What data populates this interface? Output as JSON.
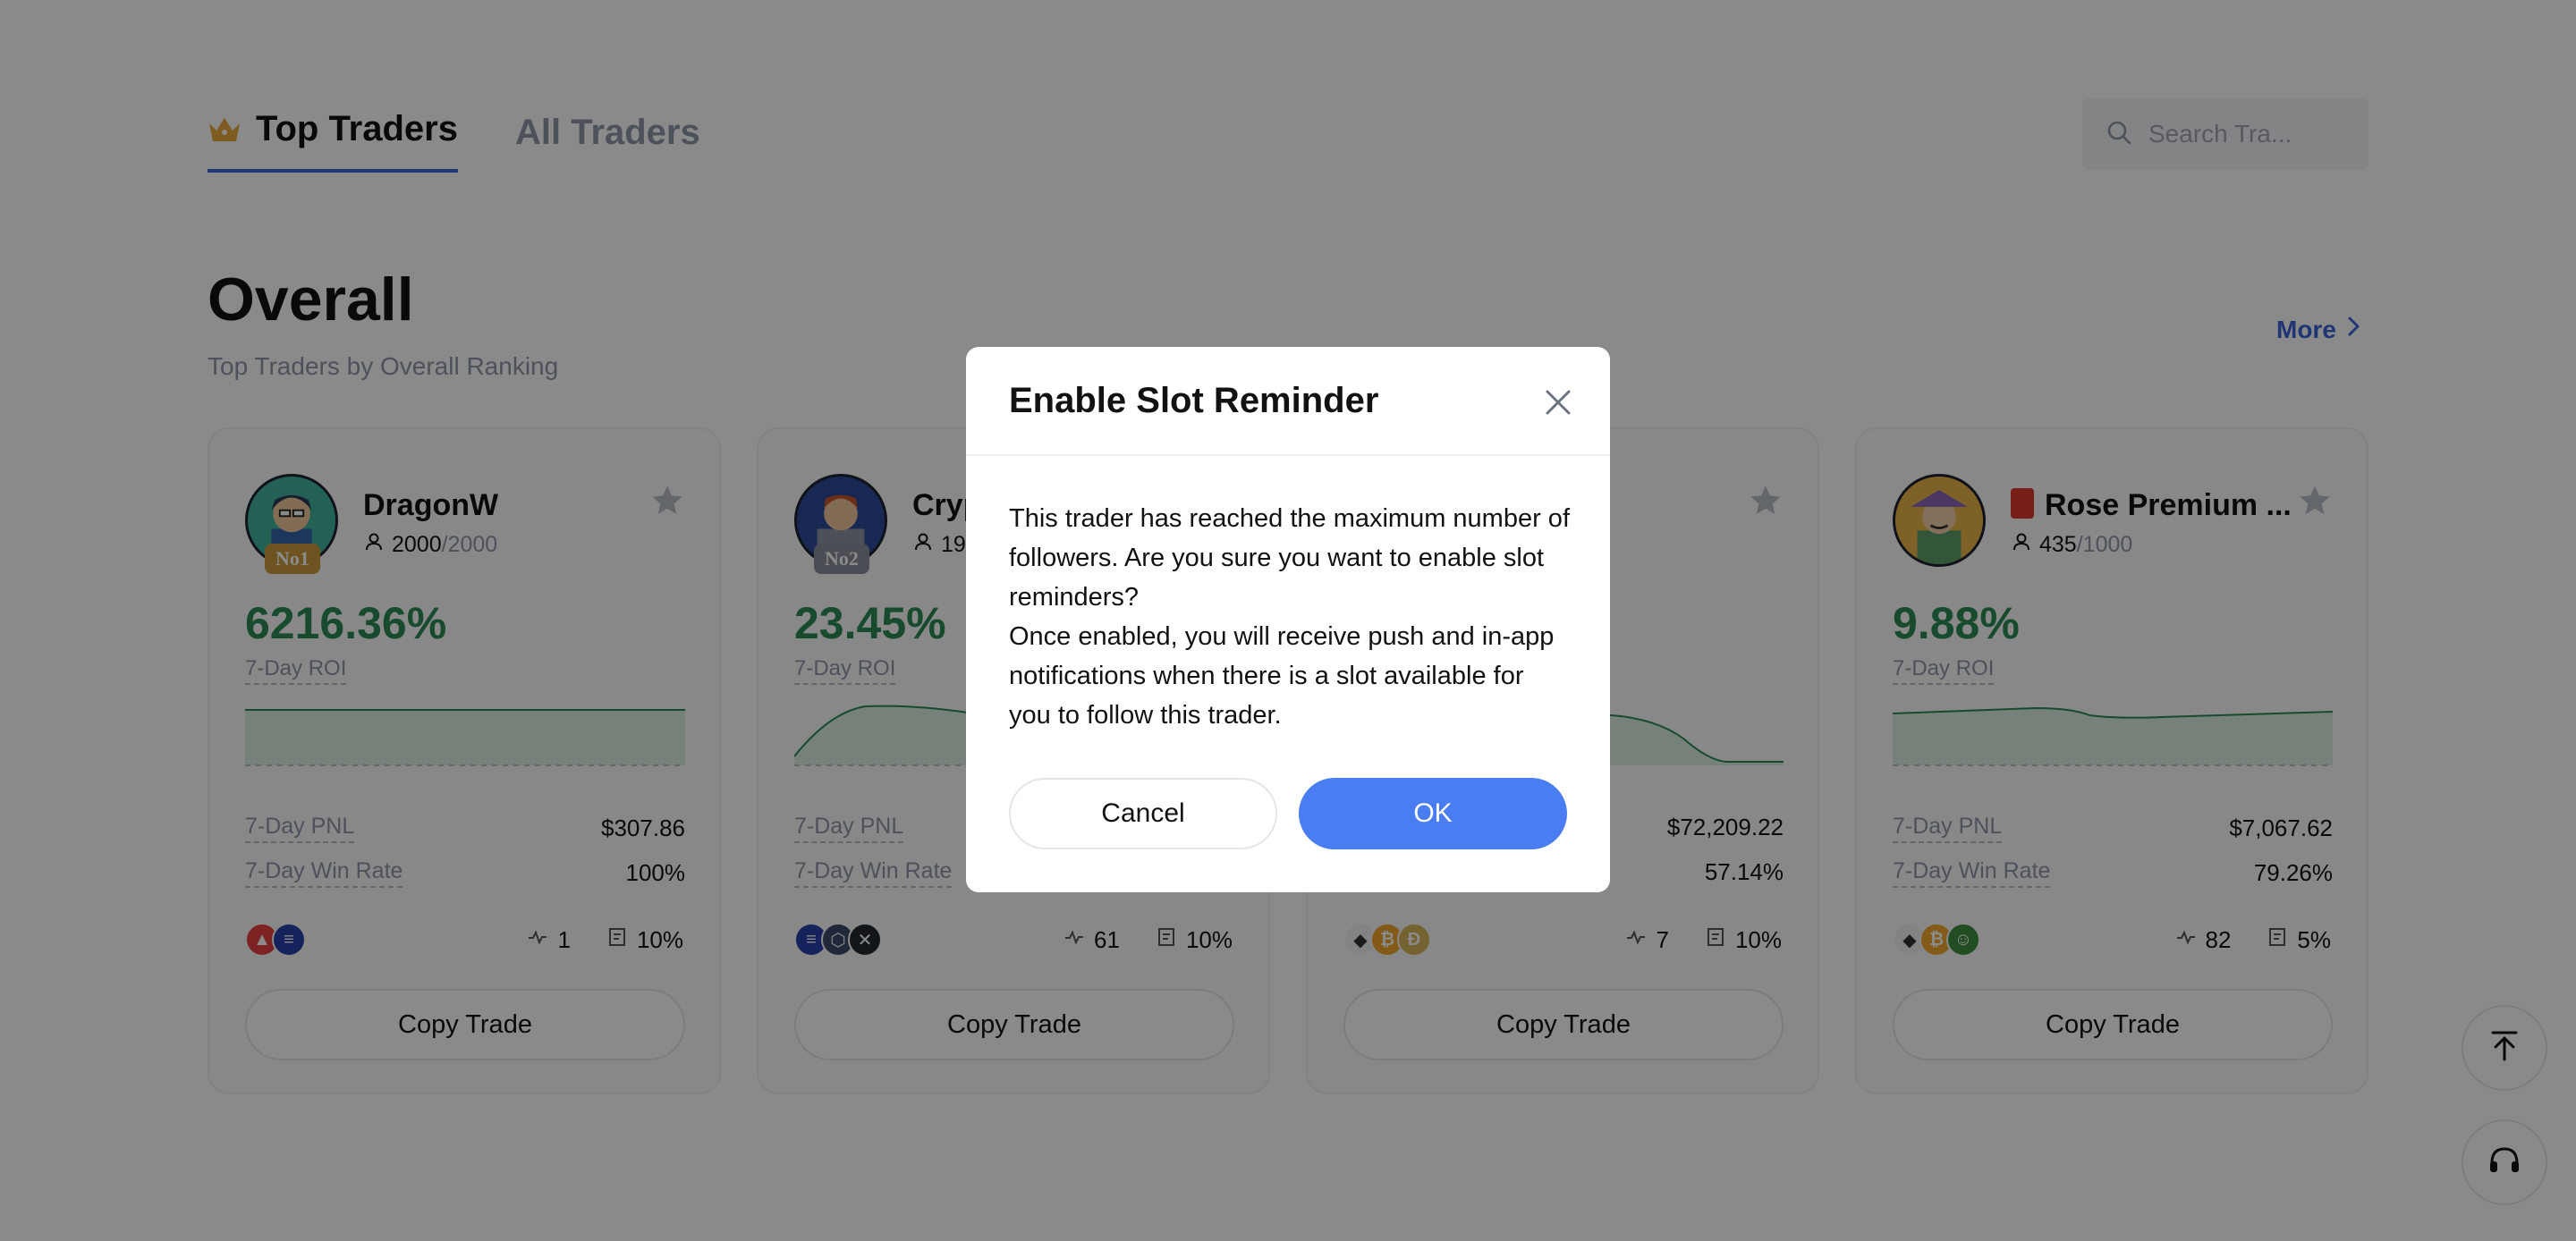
{
  "tabs": {
    "top_traders": "Top Traders",
    "all_traders": "All Traders"
  },
  "search": {
    "placeholder": "Search Tra..."
  },
  "section": {
    "title": "Overall",
    "subtitle": "Top Traders by Overall Ranking",
    "more": "More"
  },
  "cards": [
    {
      "name": "DragonW",
      "rank": "No1",
      "followers": "2000",
      "followers_max": "/2000",
      "roi": "6216.36%",
      "roi_label": "7-Day ROI",
      "pnl_label": "7-Day PNL",
      "pnl": "$307.86",
      "win_label": "7-Day Win Rate",
      "win": "100%",
      "trades": "1",
      "share": "10%",
      "copy": "Copy Trade"
    },
    {
      "name": "Cryp",
      "rank": "No2",
      "followers": "19",
      "followers_max": "",
      "roi": "23.45%",
      "roi_label": "7-Day ROI",
      "pnl_label": "7-Day PNL",
      "pnl": "",
      "win_label": "7-Day Win Rate",
      "win": "",
      "trades": "61",
      "share": "10%",
      "copy": "Copy Trade"
    },
    {
      "name": "",
      "rank": "",
      "followers": "",
      "followers_max": "",
      "roi": "",
      "roi_label": "",
      "pnl_label": "",
      "pnl": "$72,209.22",
      "win_label": "",
      "win": "57.14%",
      "trades": "7",
      "share": "10%",
      "copy": "Copy Trade"
    },
    {
      "name": "Rose Premium ...",
      "rank": "",
      "followers": "435",
      "followers_max": "/1000",
      "roi": "9.88%",
      "roi_label": "7-Day ROI",
      "pnl_label": "7-Day PNL",
      "pnl": "$7,067.62",
      "win_label": "7-Day Win Rate",
      "win": "79.26%",
      "trades": "82",
      "share": "5%",
      "copy": "Copy Trade"
    }
  ],
  "modal": {
    "title": "Enable Slot Reminder",
    "body_line1": "This trader has reached the maximum number of followers. Are you sure you want to enable slot reminders?",
    "body_line2": "Once enabled, you will receive push and in-app notifications when there is a slot available for you to follow this trader.",
    "cancel": "Cancel",
    "ok": "OK"
  },
  "colors": {
    "accent": "#4a7cf2",
    "roi_green": "#2d8a54",
    "overlay": "rgba(0,0,0,0.46)",
    "tab_underline": "#3b63d6"
  },
  "icons": {
    "tab": "crown-icon",
    "search": "search-icon",
    "more": "chevron-right-icon",
    "favorite": "star-icon",
    "followers": "user-icon",
    "trades": "activity-icon",
    "share": "receipt-icon",
    "close": "close-icon",
    "back_to_top": "arrow-up-to-line-icon",
    "support": "headset-icon"
  }
}
